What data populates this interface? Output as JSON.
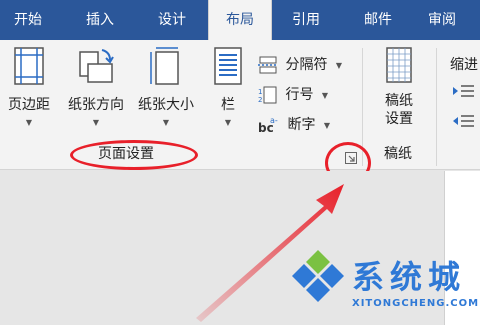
{
  "tabs": [
    "开始",
    "插入",
    "设计",
    "布局",
    "引用",
    "邮件",
    "审阅"
  ],
  "active_tab": "布局",
  "page_setup": {
    "margins": "页边距",
    "orientation": "纸张方向",
    "size": "纸张大小",
    "columns": "栏",
    "breaks": "分隔符",
    "line_numbers": "行号",
    "hyphenation": "断字",
    "group_label": "页面设置"
  },
  "manuscript": {
    "button": "稿纸设置",
    "button_line1": "稿纸",
    "button_line2": "设置",
    "group_label": "稿纸"
  },
  "indent": {
    "label": "缩进"
  },
  "annotation": {
    "color": "#e8202a",
    "highlight_target": "page-setup-dialog-launcher"
  },
  "watermark": {
    "title": "系统城",
    "subtitle": "XITONGCHENG.COM",
    "color": "#2f79d6"
  },
  "colors": {
    "ribbon_tab_bar": "#2b579a",
    "ribbon_body": "#f3f3f3"
  }
}
